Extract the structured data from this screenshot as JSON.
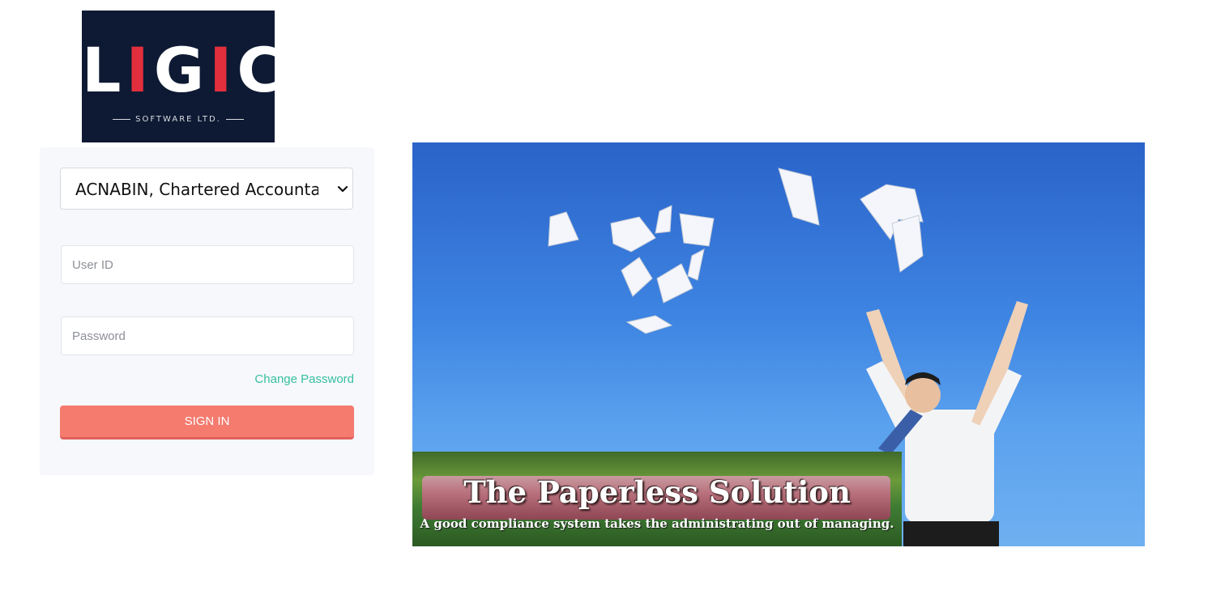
{
  "logo": {
    "word_parts": [
      "L",
      "I",
      "G",
      "I",
      "C"
    ],
    "subtitle": "SOFTWARE LTD.",
    "colors": {
      "background": "#0e1a33",
      "accent": "#e22f3d"
    }
  },
  "login": {
    "company_select": {
      "selected": "ACNABIN, Chartered Accountants"
    },
    "user_id": {
      "placeholder": "User ID",
      "value": ""
    },
    "password": {
      "placeholder": "Password",
      "value": ""
    },
    "change_password_label": "Change Password",
    "signin_label": "SIGN IN",
    "colors": {
      "signin": "#f47b6e",
      "link": "#37c0a2",
      "card": "#f7f8fc"
    }
  },
  "hero": {
    "banner_title": "The Paperless Solution",
    "banner_tagline": "A good compliance system takes the administrating out of managing."
  }
}
